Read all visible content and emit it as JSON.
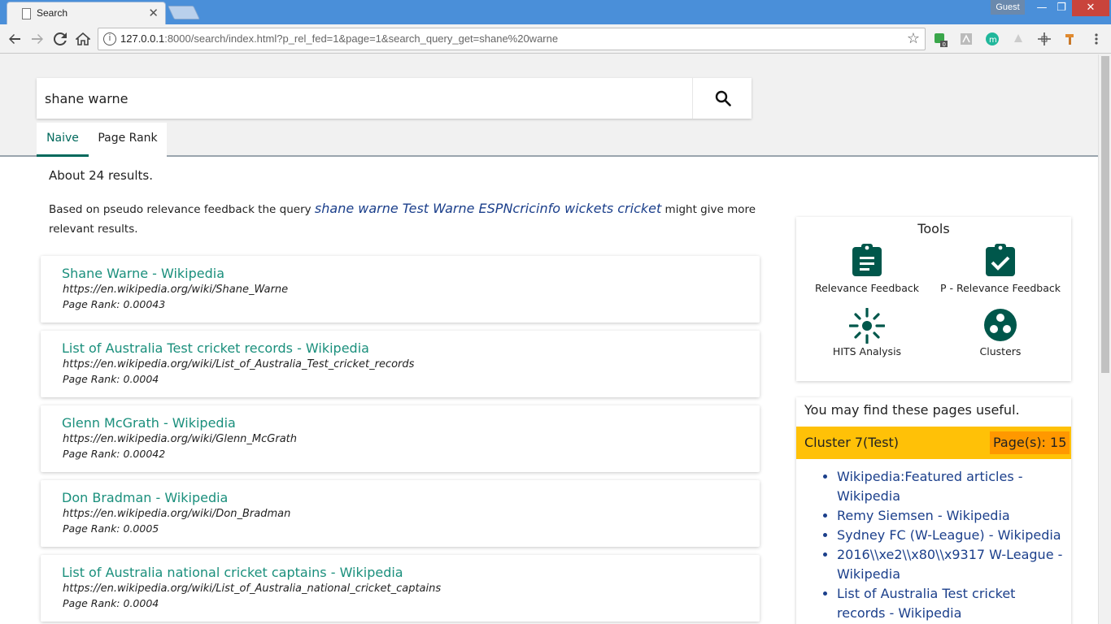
{
  "browser": {
    "tab_title": "Search",
    "tab_close": "✕",
    "profile": "Guest",
    "window_min": "—",
    "window_max": "❐",
    "window_close": "✕",
    "url_host": "127.0.0.1",
    "url_rest": ":8000/search/index.html?p_rel_fed=1&page=1&search_query_get=shane%20warne",
    "back_icon": "back-arrow-icon",
    "forward_icon": "forward-arrow-icon",
    "reload_icon": "reload-icon",
    "home_icon": "home-icon",
    "bookmark_icon": "star-icon",
    "ext_badge": "0",
    "ext_m_label": "m"
  },
  "search": {
    "query": "shane warne",
    "button_icon": "search-icon"
  },
  "tabs": [
    {
      "label": "Naive",
      "active": true
    },
    {
      "label": "Page Rank",
      "active": false
    }
  ],
  "results_summary": "About 24 results.",
  "feedback": {
    "prefix": "Based on pseudo relevance feedback the query ",
    "suggested_query": "shane warne Test Warne ESPNcricinfo wickets cricket",
    "suffix": " might give more relevant results."
  },
  "results": [
    {
      "title": "Shane Warne - Wikipedia",
      "url": "https://en.wikipedia.org/wiki/Shane_Warne",
      "page_rank": "Page Rank: 0.00043"
    },
    {
      "title": "List of Australia Test cricket records - Wikipedia",
      "url": "https://en.wikipedia.org/wiki/List_of_Australia_Test_cricket_records",
      "page_rank": "Page Rank: 0.0004"
    },
    {
      "title": "Glenn McGrath - Wikipedia",
      "url": "https://en.wikipedia.org/wiki/Glenn_McGrath",
      "page_rank": "Page Rank: 0.00042"
    },
    {
      "title": "Don Bradman - Wikipedia",
      "url": "https://en.wikipedia.org/wiki/Don_Bradman",
      "page_rank": "Page Rank: 0.0005"
    },
    {
      "title": "List of Australia national cricket captains - Wikipedia",
      "url": "https://en.wikipedia.org/wiki/List_of_Australia_national_cricket_captains",
      "page_rank": "Page Rank: 0.0004"
    }
  ],
  "tools": {
    "title": "Tools",
    "items": [
      {
        "label": "Relevance Feedback",
        "icon": "clipboard-list-icon"
      },
      {
        "label": "P - Relevance Feedback",
        "icon": "clipboard-check-icon"
      },
      {
        "label": "HITS Analysis",
        "icon": "hits-network-icon"
      },
      {
        "label": "Clusters",
        "icon": "clusters-icon"
      }
    ]
  },
  "useful": {
    "title": "You may find these pages useful.",
    "cluster_name": "Cluster 7(Test)",
    "cluster_pages": "Page(s): 15",
    "links": [
      "Wikipedia:Featured articles - Wikipedia",
      "Remy Siemsen - Wikipedia",
      "Sydney FC (W-League) - Wikipedia",
      "2016\\\\xe2\\\\x80\\\\x9317 W-League - Wikipedia",
      "List of Australia Test cricket records - Wikipedia"
    ]
  },
  "colors": {
    "accent": "#00695c",
    "result_title": "#1a8f7c",
    "link_blue": "#1b3f8b",
    "cluster_bar": "#ffc107",
    "cluster_badge": "#ff9800",
    "titlebar": "#4a8fd9"
  }
}
